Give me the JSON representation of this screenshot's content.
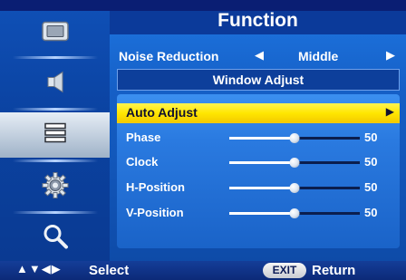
{
  "header": {
    "title": "Function"
  },
  "sidebar": {
    "items": [
      {
        "icon": "picture-icon",
        "selected": false
      },
      {
        "icon": "speaker-icon",
        "selected": false
      },
      {
        "icon": "function-icon",
        "selected": true
      },
      {
        "icon": "gear-icon",
        "selected": false
      },
      {
        "icon": "magnifier-icon",
        "selected": false
      }
    ]
  },
  "noise_reduction": {
    "label": "Noise Reduction",
    "left_arrow": "◀",
    "value": "Middle",
    "right_arrow": "▶"
  },
  "window_adjust": {
    "title": "Window Adjust"
  },
  "auto_adjust": {
    "label": "Auto Adjust",
    "arrow": "▶"
  },
  "settings": [
    {
      "label": "Phase",
      "value": "50",
      "level": 50
    },
    {
      "label": "Clock",
      "value": "50",
      "level": 50
    },
    {
      "label": "H-Position",
      "value": "50",
      "level": 50
    },
    {
      "label": "V-Position",
      "value": "50",
      "level": 50
    }
  ],
  "footer": {
    "nav_arrows": "▲▼◀▶",
    "select_label": "Select",
    "exit_key": "EXIT",
    "return_label": "Return"
  },
  "colors": {
    "background": "#0a1e73",
    "highlight": "#ffe600",
    "text": "#ffffff"
  }
}
